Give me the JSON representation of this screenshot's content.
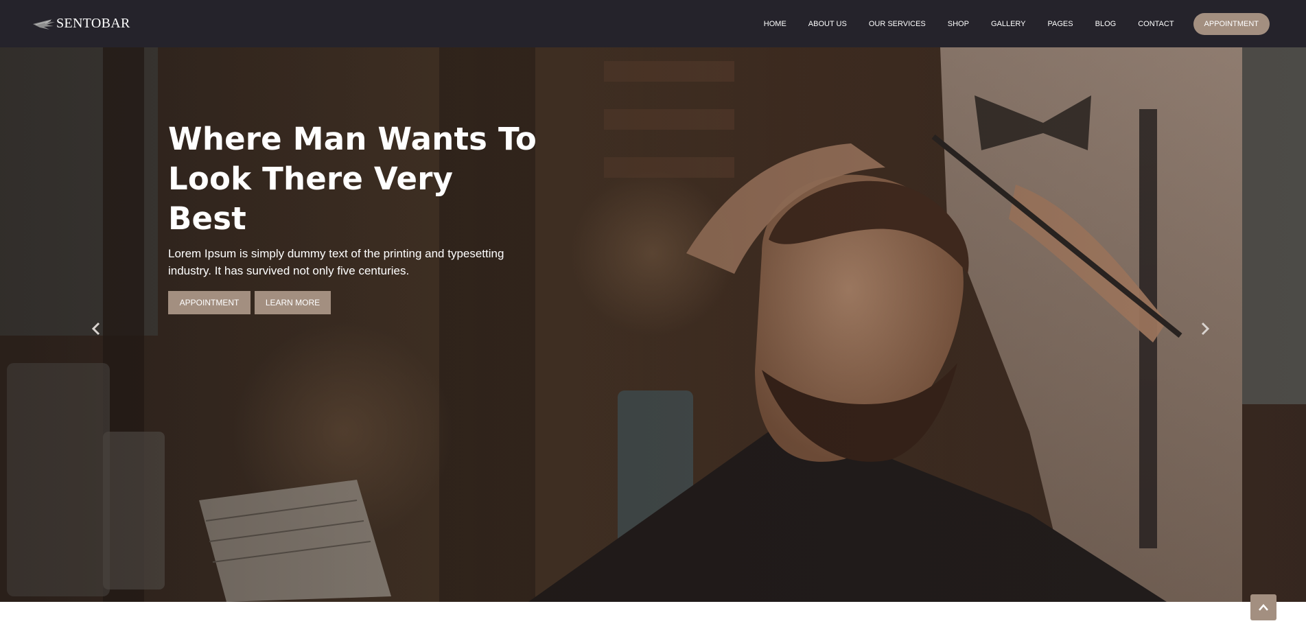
{
  "brand": {
    "name": "SENTOBAR",
    "logo_icon": "wing-icon"
  },
  "nav": {
    "items": [
      {
        "label": "HOME"
      },
      {
        "label": "ABOUT US"
      },
      {
        "label": "OUR SERVICES"
      },
      {
        "label": "SHOP"
      },
      {
        "label": "GALLERY"
      },
      {
        "label": "PAGES"
      },
      {
        "label": "BLOG"
      },
      {
        "label": "CONTACT"
      }
    ],
    "cta_label": "APPOINTMENT"
  },
  "hero": {
    "title_line1": "Where Man Wants To",
    "title_line2": "Look There Very Best",
    "text": "Lorem Ipsum is simply dummy text of the printing and typesetting industry. It has survived not only five centuries.",
    "primary_button": "APPOINTMENT",
    "secondary_button": "LEARN MORE",
    "prev_icon": "chevron-left-icon",
    "next_icon": "chevron-right-icon"
  },
  "back_to_top_icon": "chevron-up-icon",
  "colors": {
    "navbar_bg": "#25232b",
    "accent": "#a38f80",
    "text_light": "#ffffff"
  }
}
